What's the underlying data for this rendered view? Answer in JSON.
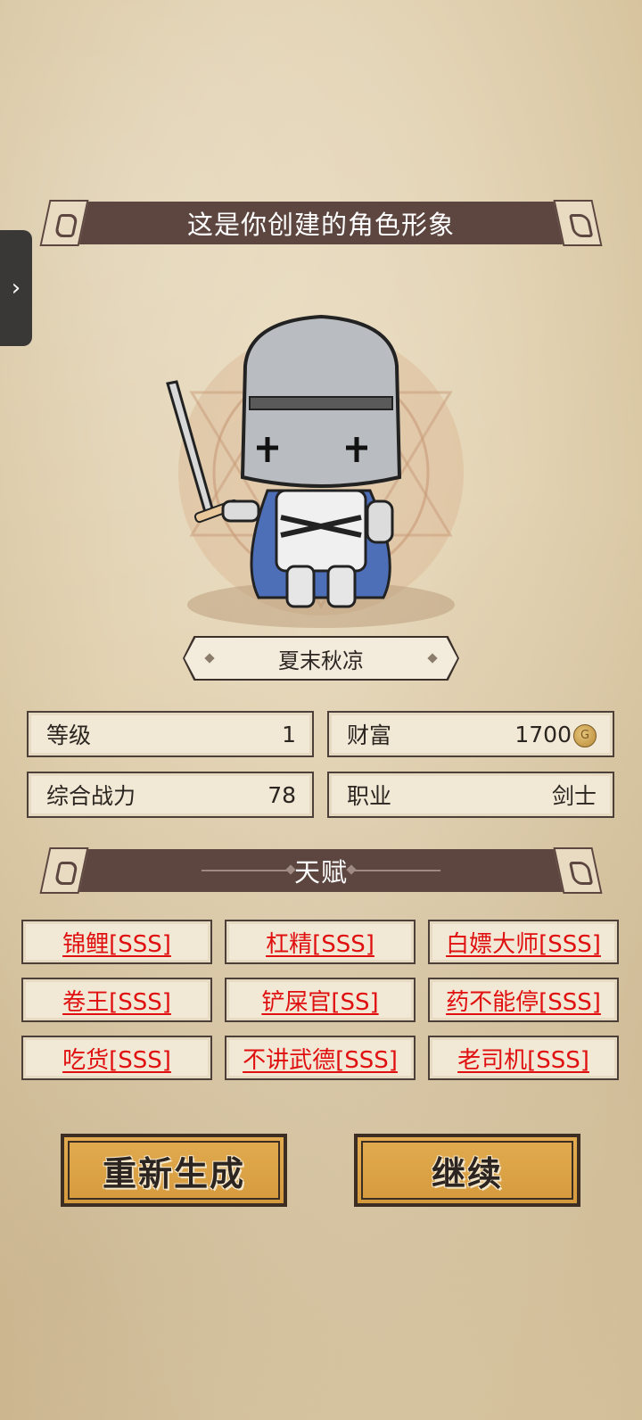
{
  "header": {
    "title": "这是你创建的角色形象"
  },
  "character": {
    "name": "夏末秋凉"
  },
  "stats": [
    {
      "label": "等级",
      "value": "1"
    },
    {
      "label": "财富",
      "value": "1700",
      "icon": "gold-coin-icon"
    },
    {
      "label": "综合战力",
      "value": "78"
    },
    {
      "label": "职业",
      "value": "剑士"
    }
  ],
  "talents_header": {
    "title": "天赋"
  },
  "talents": [
    "锦鲤[SSS]",
    "杠精[SSS]",
    "白嫖大师[SSS]",
    "卷王[SSS]",
    "铲屎官[SS]",
    "药不能停[SSS]",
    "吃货[SSS]",
    "不讲武德[SSS]",
    "老司机[SSS]"
  ],
  "buttons": {
    "regenerate": "重新生成",
    "continue": "继续"
  },
  "colors": {
    "ribbon": "#5d4640",
    "talent_text": "#e01010",
    "button": "#d69a3e"
  },
  "side_handle": {
    "icon": "chevron-right-icon",
    "glyph": "›"
  }
}
